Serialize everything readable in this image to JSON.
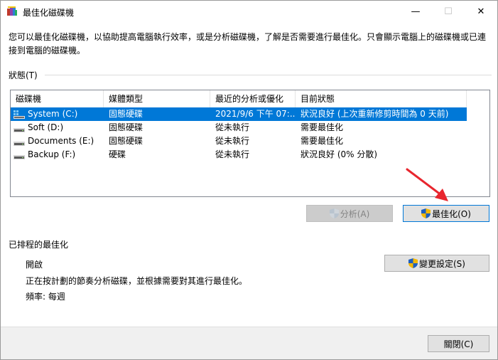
{
  "window": {
    "title": "最佳化磁碟機",
    "minimize_glyph": "—",
    "maximize_glyph": "☐",
    "close_glyph": "✕"
  },
  "description": "您可以最佳化磁碟機，以協助提高電腦執行效率，或是分析磁碟機，了解是否需要進行最佳化。只會顯示電腦上的磁碟機或已連接到電腦的磁碟機。",
  "status": {
    "group_label": "狀態(T)",
    "columns": [
      "磁碟機",
      "媒體類型",
      "最近的分析或優化",
      "目前狀態"
    ],
    "rows": [
      {
        "drive": "System (C:)",
        "media": "固態硬碟",
        "last": "2021/9/6 下午 07:...",
        "state": "狀況良好 (上次重新修剪時間為 0 天前)",
        "icon": "system-drive-icon"
      },
      {
        "drive": "Soft (D:)",
        "media": "固態硬碟",
        "last": "從未執行",
        "state": "需要最佳化",
        "icon": "drive-icon"
      },
      {
        "drive": "Documents (E:)",
        "media": "固態硬碟",
        "last": "從未執行",
        "state": "需要最佳化",
        "icon": "drive-icon"
      },
      {
        "drive": "Backup (F:)",
        "media": "硬碟",
        "last": "從未執行",
        "state": "狀況良好 (0% 分散)",
        "icon": "drive-icon"
      }
    ],
    "selected_row": 0,
    "analyze_label": "分析(A)",
    "optimize_label": "最佳化(O)"
  },
  "schedule": {
    "group_label": "已排程的最佳化",
    "state": "開啟",
    "detail": "正在按計劃的節奏分析磁碟，並根據需要對其進行最佳化。",
    "frequency": "頻率: 每週",
    "change_label": "變更設定(S)"
  },
  "footer": {
    "close_label": "關閉(C)"
  },
  "colors": {
    "accent": "#0078d7",
    "annotation_arrow": "#e8262e"
  }
}
